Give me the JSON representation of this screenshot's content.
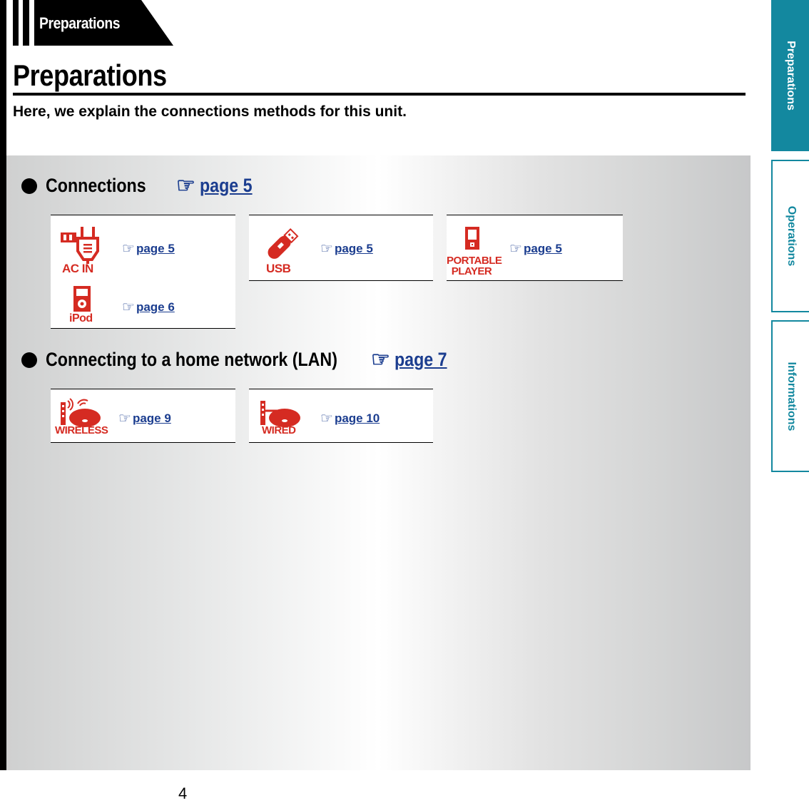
{
  "header": {
    "tab_label": "Preparations",
    "title": "Preparations",
    "subtitle": "Here, we explain the connections methods for this unit."
  },
  "sections": [
    {
      "heading": "Connections",
      "link": "page 5",
      "items": [
        {
          "icon": "ac-in-plug-icon",
          "label": "AC IN",
          "link": "page 5"
        },
        {
          "icon": "usb-stick-icon",
          "label": "USB",
          "link": "page 5"
        },
        {
          "icon": "portable-player-icon",
          "label_line1": "PORTABLE",
          "label_line2": "PLAYER",
          "link": "page 5"
        },
        {
          "icon": "ipod-icon",
          "label": "iPod",
          "link": "page 6"
        }
      ]
    },
    {
      "heading": "Connecting to a home network (LAN)",
      "link": "page 7",
      "items": [
        {
          "icon": "wireless-router-icon",
          "label": "WIRELESS",
          "link": "page 9"
        },
        {
          "icon": "wired-router-icon",
          "label": "WIRED",
          "link": "page 10"
        }
      ]
    }
  ],
  "side_tabs": [
    {
      "label": "Preparations",
      "active": true
    },
    {
      "label": "Operations",
      "active": false
    },
    {
      "label": "Informations",
      "active": false
    }
  ],
  "icons": {
    "reference": "☞"
  },
  "colors": {
    "accent": "#13889f",
    "icon_red": "#d52b22",
    "link_blue": "#1b3d8f"
  },
  "footer": {
    "page_number": "4"
  }
}
